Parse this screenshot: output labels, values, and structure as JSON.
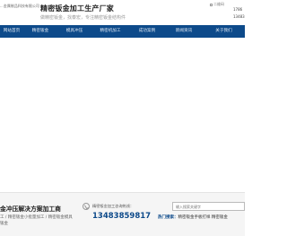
{
  "header": {
    "company_name": "...金属制品科技有限公司",
    "brand_title": "精密钣金加工生产厂家",
    "brand_slogan": "做精密钣金，找泰宏，专注精密钣金结构件",
    "qr_label": "二维码",
    "phone_line1": "1786",
    "phone_line2": "13483"
  },
  "nav": {
    "items": [
      {
        "label": "网站首页"
      },
      {
        "label": "精密钣金"
      },
      {
        "label": "模具冲压"
      },
      {
        "label": "精密机加工"
      },
      {
        "label": "成功案例"
      },
      {
        "label": "新闻资讯"
      },
      {
        "label": "关于我们"
      }
    ]
  },
  "bottom": {
    "solution_title": "金冲压解决方案加工商",
    "breadcrumb_line1": "工 / 精密钣金小批量加工 / 精密钣金模具",
    "breadcrumb_line2": "钣金",
    "hotline_label": "精密钣金加工咨询热线：",
    "hotline_number": "13483859817",
    "search_placeholder": "输入搜索关键字",
    "hot_search_label": "热门搜索：",
    "hot_search_terms": "精密钣金手板打样  精密钣金"
  },
  "colors": {
    "nav_background": "#0d4a8a",
    "hotline_number": "#0d4a8a"
  },
  "icons": {
    "qr": "qr-code-icon",
    "hotline": "phone-icon"
  }
}
